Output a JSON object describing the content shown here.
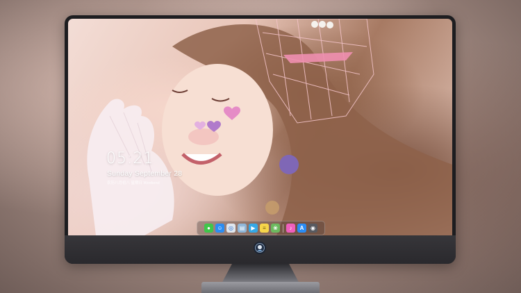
{
  "lockscreen": {
    "time": "05:21",
    "date": "Sunday  September  28",
    "lunar_line": "农历八月初八  星期日  Weekend"
  },
  "dock": {
    "apps": [
      {
        "name": "messages",
        "icon": "messages-icon",
        "color": "#3fc64a",
        "glyph": "●"
      },
      {
        "name": "finder",
        "icon": "finder-icon",
        "color": "#2b8df3",
        "glyph": "☺"
      },
      {
        "name": "safari",
        "icon": "safari-icon",
        "color": "#dfe6ee",
        "glyph": "◎"
      },
      {
        "name": "files",
        "icon": "files-icon",
        "color": "#8fb6d8",
        "glyph": "▤"
      },
      {
        "name": "video",
        "icon": "video-icon",
        "color": "#35a8e6",
        "glyph": "▶"
      },
      {
        "name": "notes",
        "icon": "notes-icon",
        "color": "#f6d54a",
        "glyph": "≡"
      },
      {
        "name": "photos",
        "icon": "photos-icon",
        "color": "#6cba5f",
        "glyph": "❀"
      },
      {
        "name": "music",
        "icon": "music-icon",
        "color": "#ef5fbd",
        "glyph": "♪"
      },
      {
        "name": "app-store",
        "icon": "app-store-icon",
        "color": "#2a8cf4",
        "glyph": "A"
      },
      {
        "name": "camera",
        "icon": "camera-icon",
        "color": "#585a60",
        "glyph": "◉"
      }
    ]
  },
  "colors": {
    "bezel": "#1d1d20",
    "chin": "#2a292d",
    "accent": "#ffffff"
  }
}
